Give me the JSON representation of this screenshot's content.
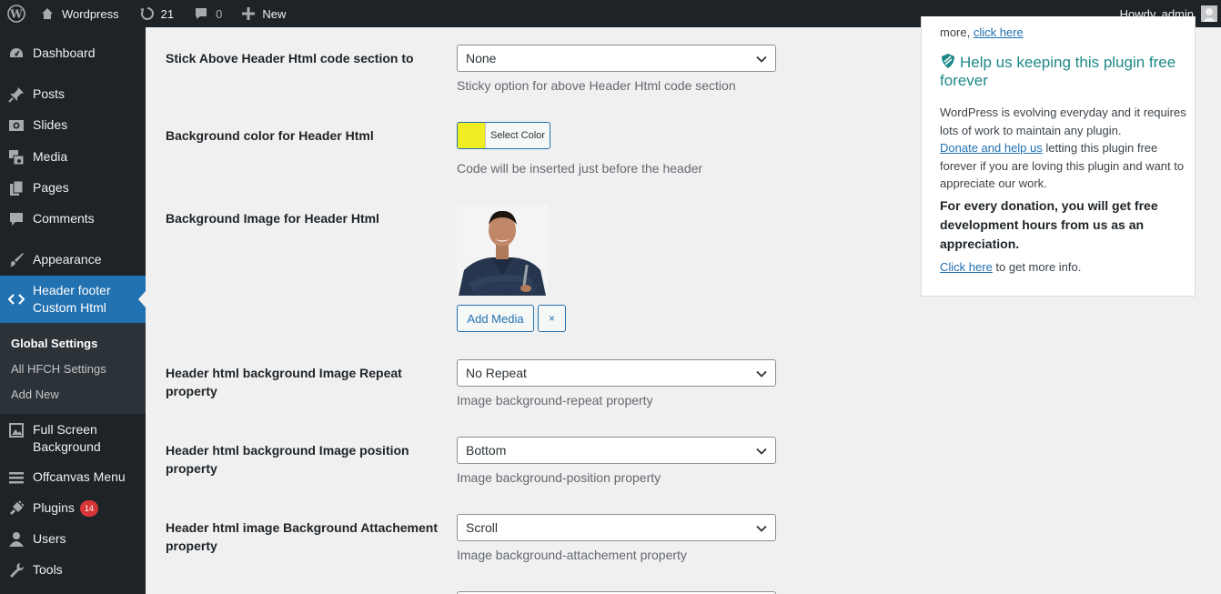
{
  "adminbar": {
    "site_name": "Wordpress",
    "updates_count": "21",
    "comments_count": "0",
    "new_label": "New",
    "greeting": "Howdy, admin"
  },
  "sidebar": {
    "items": [
      {
        "label": "Dashboard",
        "icon": "dashboard-icon"
      },
      {
        "label": "Posts",
        "icon": "pin-icon"
      },
      {
        "label": "Slides",
        "icon": "visibility-icon"
      },
      {
        "label": "Media",
        "icon": "media-icon"
      },
      {
        "label": "Pages",
        "icon": "pages-icon"
      },
      {
        "label": "Comments",
        "icon": "comment-icon"
      },
      {
        "label": "Appearance",
        "icon": "brush-icon"
      },
      {
        "label": "Header footer Custom Html",
        "icon": "code-icon"
      },
      {
        "label": "Full Screen Background",
        "icon": "image-icon"
      },
      {
        "label": "Offcanvas Menu",
        "icon": "menu-icon"
      },
      {
        "label": "Plugins",
        "icon": "plugin-icon",
        "badge": "14"
      },
      {
        "label": "Users",
        "icon": "users-icon"
      },
      {
        "label": "Tools",
        "icon": "tools-icon"
      }
    ],
    "submenu": [
      "Global Settings",
      "All HFCH Settings",
      "Add New"
    ]
  },
  "settings": {
    "stick_label": "Stick Above Header Html code section to",
    "stick_value": "None",
    "stick_desc": "Sticky option for above Header Html code section",
    "bgcolor_label": "Background color for Header Html",
    "bgcolor_button": "Select Color",
    "bgcolor_value": "#eeee22",
    "bgcolor_desc": "Code will be inserted just before the header",
    "bgimage_label": "Background Image for Header Html",
    "add_media": "Add Media",
    "remove": "×",
    "repeat_label": "Header html background Image Repeat property",
    "repeat_value": "No Repeat",
    "repeat_desc": "Image background-repeat property",
    "position_label": "Header html background Image position property",
    "position_value": "Bottom",
    "position_desc": "Image background-position property",
    "attach_label": "Header html image Background Attachement property",
    "attach_value": "Scroll",
    "attach_desc": "Image background-attachement property"
  },
  "widget": {
    "top_more": "more,",
    "top_link": "click here",
    "title": "Help us keeping this plugin free forever",
    "para_1": "WordPress is evolving everyday and it requires lots of work to maintain any plugin.",
    "donate_link": "Donate and help us",
    "para_2": "letting this plugin free forever if you are loving this plugin and want to appreciate our work.",
    "bold_text": "For every donation, you will get free development hours from us as an appreciation.",
    "click_here": "Click here",
    "info_text": "to get more info."
  }
}
